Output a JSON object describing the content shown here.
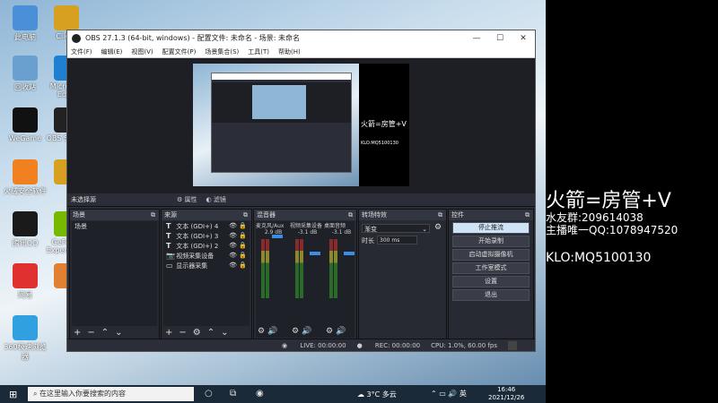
{
  "overlay": {
    "line1": "火箭=房管+V",
    "line2": "水友群:209614038",
    "line3": "主播唯一QQ:1078947520",
    "line4": "KLO:MQ5100130"
  },
  "desktop": {
    "icons": [
      {
        "label": "此电脑",
        "icon": "computer-icon",
        "color": "#4a90d9"
      },
      {
        "label": "Client",
        "icon": "client-icon",
        "color": "#d8a020"
      },
      {
        "label": "回收站",
        "icon": "recycle-bin-icon",
        "color": "#6aa0d0"
      },
      {
        "label": "Microsoft Edge",
        "icon": "edge-icon",
        "color": "#1f7fd0"
      },
      {
        "label": "WeGame",
        "icon": "wegame-icon",
        "color": "#111111"
      },
      {
        "label": "OBS Studio",
        "icon": "obs-icon",
        "color": "#222222"
      },
      {
        "label": "火绒安全软件",
        "icon": "huorong-icon",
        "color": "#f08020"
      },
      {
        "label": "",
        "icon": "app-icon",
        "color": "#d8a020"
      },
      {
        "label": "腾讯QQ",
        "icon": "qq-icon",
        "color": "#1a1a1a"
      },
      {
        "label": "GeForce Experience",
        "icon": "nvidia-icon",
        "color": "#76b900"
      },
      {
        "label": "网易",
        "icon": "netease-icon",
        "color": "#e03030"
      },
      {
        "label": "",
        "icon": "app2-icon",
        "color": "#e08030"
      },
      {
        "label": "360极速浏览器",
        "icon": "browser-icon",
        "color": "#30a0e0"
      }
    ]
  },
  "obs": {
    "title": "OBS 27.1.3 (64-bit, windows) - 配置文件: 未命名 - 场景: 未命名",
    "menu": [
      "文件(F)",
      "编辑(E)",
      "视图(V)",
      "配置文件(P)",
      "场景集合(S)",
      "工具(T)",
      "帮助(H)"
    ],
    "preview_text1": "火箭=房管+V",
    "preview_text2": "KLO:MQ5100130",
    "scenebar": {
      "label": "未选择源",
      "properties": "属性",
      "filters": "滤镜"
    },
    "scenes": {
      "header": "场景",
      "items": [
        "场景"
      ]
    },
    "sources": {
      "header": "来源",
      "items": [
        {
          "icon": "T",
          "name": "文本 (GDI+) 4"
        },
        {
          "icon": "T",
          "name": "文本 (GDI+) 3"
        },
        {
          "icon": "T",
          "name": "文本 (GDI+) 2"
        },
        {
          "icon": "📷",
          "name": "视频采集设备"
        },
        {
          "icon": "▭",
          "name": "显示器采集"
        }
      ]
    },
    "mixer": {
      "header": "混音器",
      "channels": [
        {
          "name": "麦克风/Aux",
          "db": "2.9 dB"
        },
        {
          "name": "视频采集设备",
          "db": "-3.1 dB"
        },
        {
          "name": "桌面音频",
          "db": "-3.1 dB"
        }
      ]
    },
    "transitions": {
      "header": "转场特效",
      "type": "渐变",
      "duration_label": "时长",
      "duration": "300 ms"
    },
    "controls": {
      "header": "控件",
      "buttons": [
        "停止推流",
        "开始录制",
        "启动虚拟摄像机",
        "工作室模式",
        "设置",
        "退出"
      ]
    },
    "status": {
      "live": "LIVE: 00:00:00",
      "rec": "REC: 00:00:00",
      "cpu": "CPU: 1.0%, 60.00 fps"
    }
  },
  "taskbar": {
    "search_placeholder": "在这里输入你要搜索的内容",
    "weather": "3°C 多云",
    "lang": "英",
    "time": "16:46",
    "date": "2021/12/26"
  }
}
